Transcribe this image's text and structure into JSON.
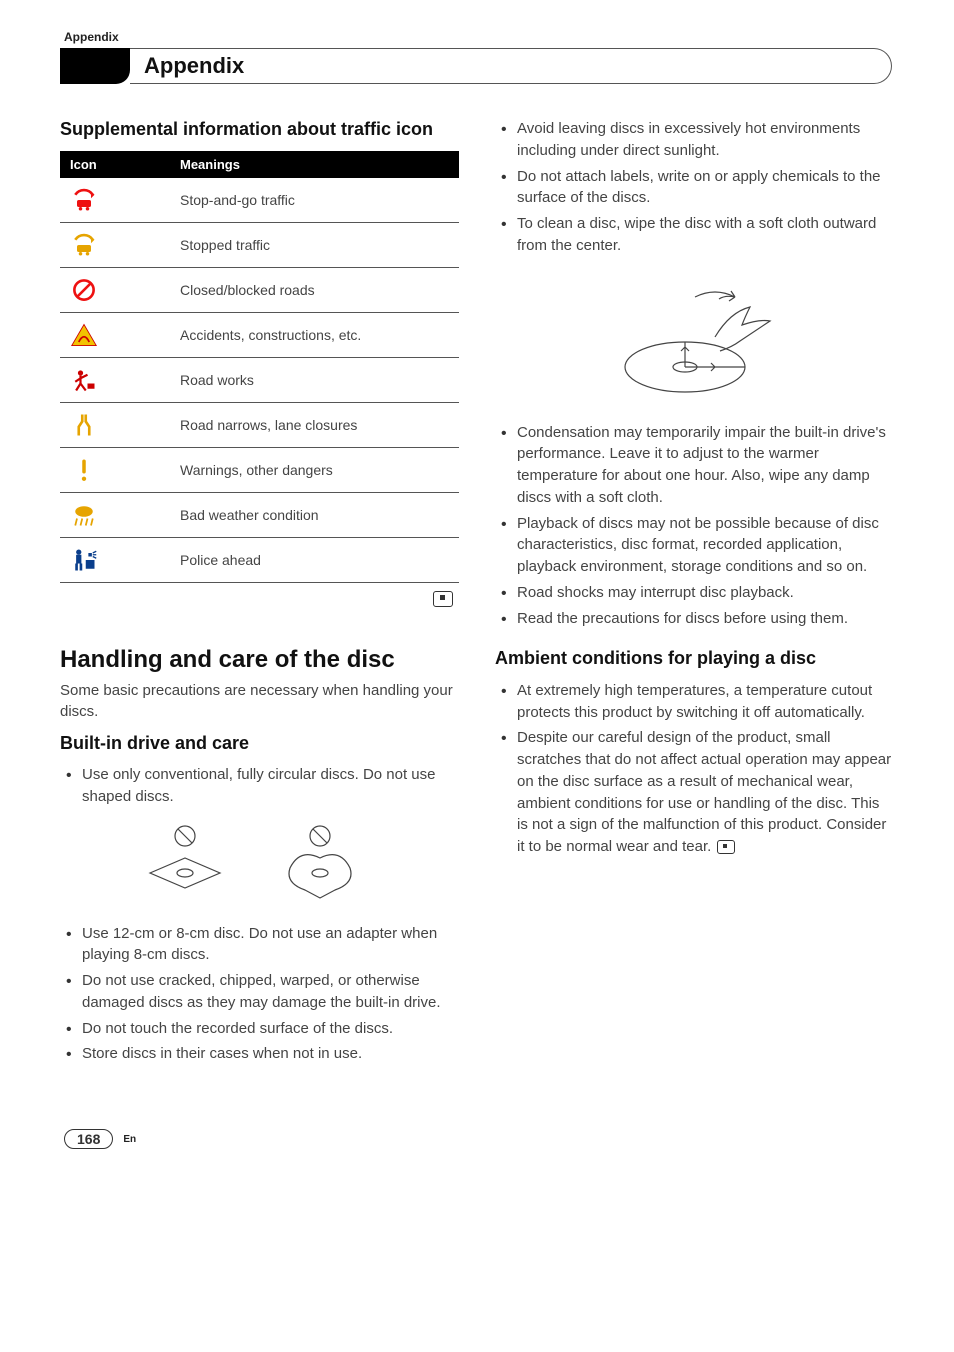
{
  "breadcrumb": "Appendix",
  "tab_title": "Appendix",
  "left": {
    "sub1": "Supplemental information about traffic icon",
    "table": {
      "headers": [
        "Icon",
        "Meanings"
      ],
      "rows": [
        {
          "meaning": "Stop-and-go traffic"
        },
        {
          "meaning": "Stopped traffic"
        },
        {
          "meaning": "Closed/blocked roads"
        },
        {
          "meaning": "Accidents, constructions, etc."
        },
        {
          "meaning": "Road works"
        },
        {
          "meaning": "Road narrows, lane closures"
        },
        {
          "meaning": "Warnings, other dangers"
        },
        {
          "meaning": "Bad weather condition"
        },
        {
          "meaning": "Police ahead"
        }
      ]
    },
    "h1": "Handling and care of the disc",
    "intro": "Some basic precautions are necessary when handling your discs.",
    "sub2": "Built-in drive and care",
    "bullets_a": [
      "Use only conventional, fully circular discs. Do not use shaped discs."
    ],
    "bullets_b": [
      "Use 12-cm or 8-cm disc. Do not use an adapter when playing 8-cm discs.",
      "Do not use cracked, chipped, warped, or otherwise damaged discs as they may damage the built-in drive.",
      "Do not touch the recorded surface of the discs.",
      "Store discs in their cases when not in use."
    ]
  },
  "right": {
    "bullets_c": [
      "Avoid leaving discs in excessively hot environments including under direct sunlight.",
      "Do not attach labels, write on or apply chemicals to the surface of the discs.",
      "To clean a disc, wipe the disc with a soft cloth outward from the center."
    ],
    "bullets_d": [
      "Condensation may temporarily impair the built-in drive's performance. Leave it to adjust to the warmer temperature for about one hour. Also, wipe any damp discs with a soft cloth.",
      "Playback of discs may not be possible because of disc characteristics, disc format, recorded application, playback environment, storage conditions and so on.",
      "Road shocks may interrupt disc playback.",
      "Read the precautions for discs before using them."
    ],
    "sub3": "Ambient conditions for playing a disc",
    "bullets_e": [
      "At extremely high temperatures, a temperature cutout protects this product by switching it off automatically."
    ],
    "bullet_e_last": "Despite our careful design of the product, small scratches that do not affect actual operation may appear on the disc surface as a result of mechanical wear, ambient conditions for use or handling of the disc. This is not a sign of the malfunction of this product. Consider it to be normal wear and tear."
  },
  "footer": {
    "page": "168",
    "lang": "En"
  }
}
